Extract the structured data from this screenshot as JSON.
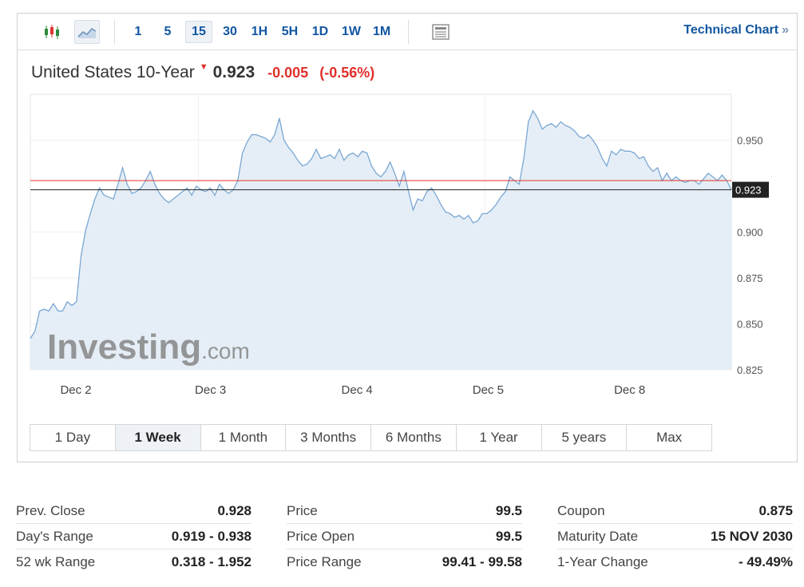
{
  "toolbar": {
    "timeframes": [
      "1",
      "5",
      "15",
      "30",
      "1H",
      "5H",
      "1D",
      "1W",
      "1M"
    ],
    "active_timeframe": "15",
    "technical_chart_label": "Technical Chart",
    "technical_chart_chevron": "»",
    "icons": [
      "candlestick-icon",
      "area-chart-icon",
      "news-icon"
    ]
  },
  "quote": {
    "name": "United States 10-Year",
    "last": "0.923",
    "change": "-0.005",
    "change_pct": "(-0.56%)",
    "direction_arrow": "▼",
    "negative_color": "#e0302a"
  },
  "chart_data": {
    "type": "area",
    "ylim": [
      0.825,
      0.975
    ],
    "yticks": [
      0.825,
      0.85,
      0.875,
      0.9,
      0.95
    ],
    "xticks": [
      "Dec 2",
      "Dec 3",
      "Dec 4",
      "Dec 5",
      "Dec 8"
    ],
    "current_value": 0.923,
    "current_label": "0.923",
    "prev_close": 0.928,
    "grid": true,
    "watermark": "Investing.com",
    "series": [
      {
        "line_color": "#7aa7d3",
        "fill_color": "#e5eef6",
        "values": [
          0.842,
          0.846,
          0.857,
          0.858,
          0.857,
          0.861,
          0.857,
          0.857,
          0.862,
          0.86,
          0.862,
          0.887,
          0.901,
          0.91,
          0.918,
          0.924,
          0.92,
          0.919,
          0.918,
          0.926,
          0.935,
          0.926,
          0.921,
          0.922,
          0.924,
          0.928,
          0.933,
          0.926,
          0.921,
          0.918,
          0.916,
          0.918,
          0.92,
          0.922,
          0.924,
          0.92,
          0.925,
          0.923,
          0.922,
          0.924,
          0.92,
          0.926,
          0.923,
          0.921,
          0.923,
          0.928,
          0.943,
          0.949,
          0.953,
          0.953,
          0.952,
          0.951,
          0.949,
          0.953,
          0.962,
          0.95,
          0.946,
          0.943,
          0.939,
          0.936,
          0.937,
          0.94,
          0.945,
          0.94,
          0.941,
          0.942,
          0.94,
          0.945,
          0.939,
          0.942,
          0.943,
          0.941,
          0.944,
          0.943,
          0.936,
          0.932,
          0.93,
          0.933,
          0.938,
          0.932,
          0.925,
          0.933,
          0.922,
          0.912,
          0.918,
          0.917,
          0.922,
          0.924,
          0.92,
          0.915,
          0.911,
          0.91,
          0.908,
          0.909,
          0.907,
          0.909,
          0.905,
          0.906,
          0.91,
          0.91,
          0.912,
          0.915,
          0.919,
          0.922,
          0.93,
          0.928,
          0.926,
          0.94,
          0.96,
          0.966,
          0.962,
          0.956,
          0.958,
          0.959,
          0.957,
          0.96,
          0.958,
          0.957,
          0.955,
          0.952,
          0.951,
          0.953,
          0.95,
          0.946,
          0.94,
          0.936,
          0.944,
          0.942,
          0.945,
          0.944,
          0.944,
          0.943,
          0.94,
          0.941,
          0.936,
          0.933,
          0.935,
          0.928,
          0.932,
          0.928,
          0.93,
          0.928,
          0.927,
          0.928,
          0.928,
          0.926,
          0.929,
          0.932,
          0.93,
          0.928,
          0.931,
          0.928,
          0.923
        ]
      }
    ]
  },
  "periods": [
    "1 Day",
    "1 Week",
    "1 Month",
    "3 Months",
    "6 Months",
    "1 Year",
    "5 years",
    "Max"
  ],
  "active_period": "1 Week",
  "stats": [
    [
      {
        "label": "Prev. Close",
        "value": "0.928"
      },
      {
        "label": "Day's Range",
        "value": "0.919 - 0.938"
      },
      {
        "label": "52 wk Range",
        "value": "0.318 - 1.952"
      }
    ],
    [
      {
        "label": "Price",
        "value": "99.5"
      },
      {
        "label": "Price Open",
        "value": "99.5"
      },
      {
        "label": "Price Range",
        "value": "99.41 - 99.58"
      }
    ],
    [
      {
        "label": "Coupon",
        "value": "0.875"
      },
      {
        "label": "Maturity Date",
        "value": "15 NOV 2030"
      },
      {
        "label": "1-Year Change",
        "value": "- 49.49%"
      }
    ]
  ]
}
